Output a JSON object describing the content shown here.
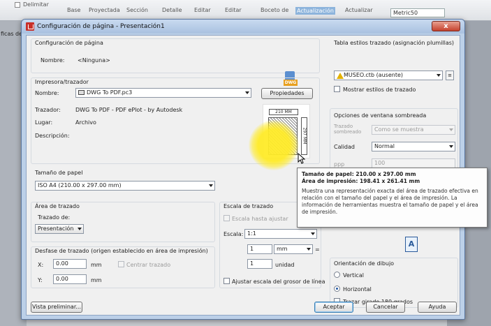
{
  "ribbon": {
    "items": [
      "Delimitar",
      "Base",
      "Proyectada",
      "Sección",
      "Detalle",
      "Editar",
      "Editar",
      "Boceto de",
      "Actualización",
      "Actualizar"
    ],
    "selected_index": 8,
    "left_label": "ficas de",
    "metric_value": "Metric50"
  },
  "dialog": {
    "title": "Configuración de página - Presentación1",
    "close_label": "x",
    "page_setup": {
      "group_label": "Configuración de página",
      "name_label": "Nombre:",
      "name_value": "<Ninguna>",
      "dwg_icon_text": "DWG"
    },
    "printer": {
      "group_label": "Impresora/trazador",
      "name_label": "Nombre:",
      "name_value": "DWG To PDF.pc3",
      "properties_button": "Propiedades",
      "plotter_label": "Trazador:",
      "plotter_value": "DWG To PDF - PDF ePlot - by Autodesk",
      "where_label": "Lugar:",
      "where_value": "Archivo",
      "desc_label": "Descripción:",
      "preview_width": "210 MM",
      "preview_height": "297 MM"
    },
    "paper_size": {
      "group_label": "Tamaño de papel",
      "value": "ISO A4 (210.00 x 297.00 mm)"
    },
    "plot_area": {
      "group_label": "Área de trazado",
      "what_label": "Trazado de:",
      "what_value": "Presentación"
    },
    "plot_offset": {
      "group_label": "Desfase de trazado (origen establecido en área de impresión)",
      "x_label": "X:",
      "x_value": "0.00",
      "x_unit": "mm",
      "center_label": "Centrar trazado",
      "y_label": "Y:",
      "y_value": "0.00",
      "y_unit": "mm"
    },
    "plot_scale": {
      "group_label": "Escala de trazado",
      "fit_label": "Escala hasta ajustar",
      "scale_label": "Escala:",
      "scale_value": "1:1",
      "value1": "1",
      "unit1": "mm",
      "equals": "=",
      "value2": "1",
      "unit2": "unidad",
      "lineweights_label": "Ajustar escala del grosor de línea"
    },
    "plot_style": {
      "group_label": "Tabla estilos trazado (asignación plumillas)",
      "value": "MUSEO.ctb (ausente)",
      "show_label": "Mostrar estilos de trazado"
    },
    "shaded": {
      "group_label": "Opciones de ventana sombreada",
      "shade_label_1": "Trazado",
      "shade_label_2": "sombreado",
      "shade_value": "Como se muestra",
      "quality_label": "Calidad",
      "quality_value": "Normal",
      "dpi_label": "ppp",
      "dpi_value": "100"
    },
    "orientation": {
      "group_label": "Orientación de dibujo",
      "portrait_label": "Vertical",
      "landscape_label": "Horizontal",
      "upside_label": "Trazar girado 180 grados",
      "icon_glyph": "A"
    },
    "buttons": {
      "preview": "Vista preliminar...",
      "ok": "Aceptar",
      "cancel": "Cancelar",
      "help": "Ayuda"
    }
  },
  "tooltip": {
    "paper_size": "Tamaño de papel:  210.00 x 297.00 mm",
    "print_area": "Área de impresión:  198.41 x 261.41 mm",
    "description": "Muestra una representación exacta del área de trazado efectiva en relación con el tamaño del papel y el área de impresión. La información de herramientas muestra el tamaño de papel y el área de impresión."
  },
  "colors": {
    "accent": "#3c7fb1",
    "title_bar": "#a9c1e0",
    "close_button": "#c5412d",
    "highlight": "#ffeb28"
  }
}
